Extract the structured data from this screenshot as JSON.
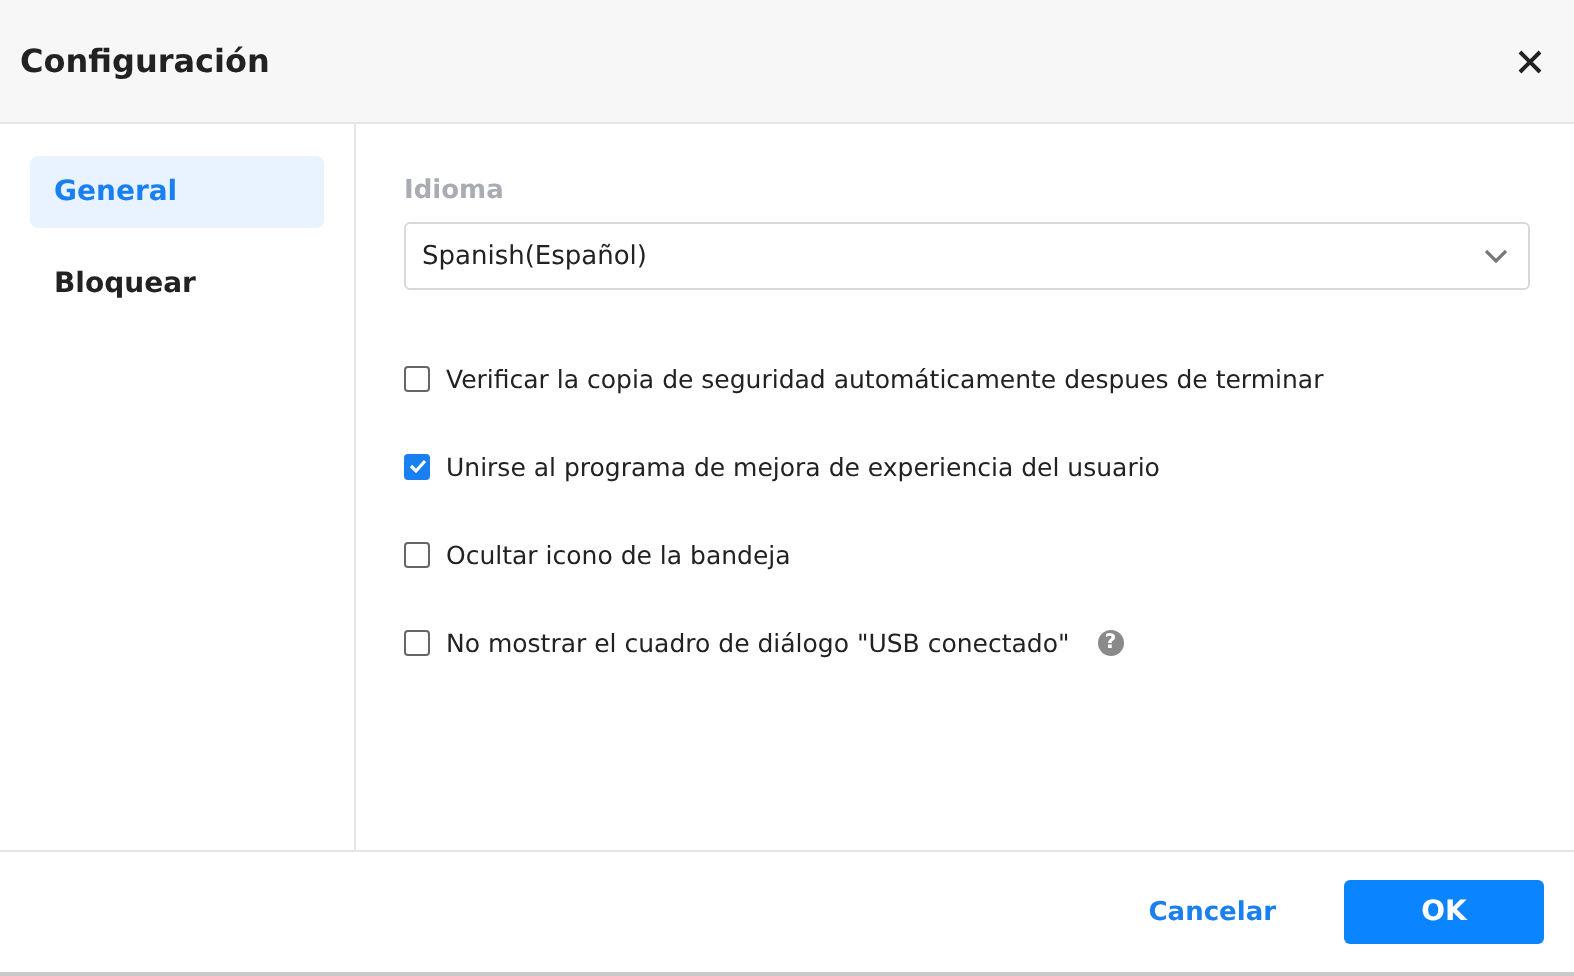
{
  "window": {
    "title": "Configuración"
  },
  "sidebar": {
    "items": [
      {
        "label": "General",
        "selected": true
      },
      {
        "label": "Bloquear",
        "selected": false
      }
    ]
  },
  "language": {
    "label": "Idioma",
    "value": "Spanish(Español)"
  },
  "options": [
    {
      "label": "Verificar la copia de seguridad automáticamente despues de terminar",
      "checked": false
    },
    {
      "label": "Unirse al programa de mejora de experiencia del usuario",
      "checked": true
    },
    {
      "label": "Ocultar icono de la bandeja",
      "checked": false
    },
    {
      "label": "No mostrar el cuadro de diálogo \"USB conectado\"",
      "checked": false,
      "help": "?"
    }
  ],
  "buttons": {
    "cancel": "Cancelar",
    "ok": "OK"
  }
}
